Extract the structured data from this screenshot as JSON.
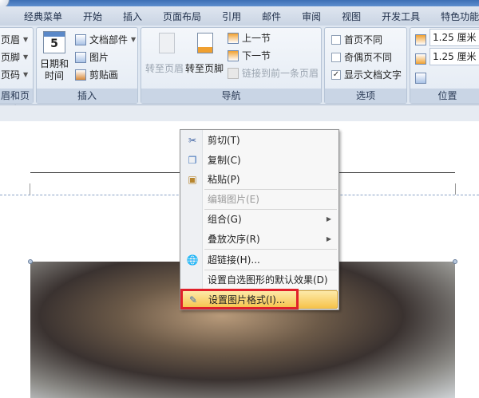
{
  "tabs": [
    "经典菜单",
    "开始",
    "插入",
    "页面布局",
    "引用",
    "邮件",
    "审阅",
    "视图",
    "开发工具",
    "特色功能"
  ],
  "groups": {
    "header_footer": {
      "label": "眉和页脚",
      "items": [
        "页眉",
        "页脚",
        "页码"
      ]
    },
    "insert": {
      "label": "插入",
      "date_time": "日期和时间",
      "doc_parts": "文档部件",
      "picture": "图片",
      "clipart": "剪贴画"
    },
    "navigation": {
      "label": "导航",
      "goto_header": "转至页眉",
      "goto_footer": "转至页脚",
      "prev_section": "上一节",
      "next_section": "下一节",
      "link_prev": "链接到前一条页眉"
    },
    "options": {
      "label": "选项",
      "diff_first": "首页不同",
      "diff_odd_even": "奇偶页不同",
      "show_doc_text": "显示文档文字",
      "checked": [
        false,
        false,
        true
      ]
    },
    "position": {
      "label": "位置",
      "header_dist": "1.25 厘米",
      "footer_dist": "1.25 厘米"
    }
  },
  "context_menu": {
    "cut": "剪切(T)",
    "copy": "复制(C)",
    "paste": "粘贴(P)",
    "edit_picture": "编辑图片(E)",
    "group": "组合(G)",
    "order": "叠放次序(R)",
    "hyperlink": "超链接(H)...",
    "set_default": "设置自选图形的默认效果(D)",
    "format_picture": "设置图片格式(I)..."
  }
}
